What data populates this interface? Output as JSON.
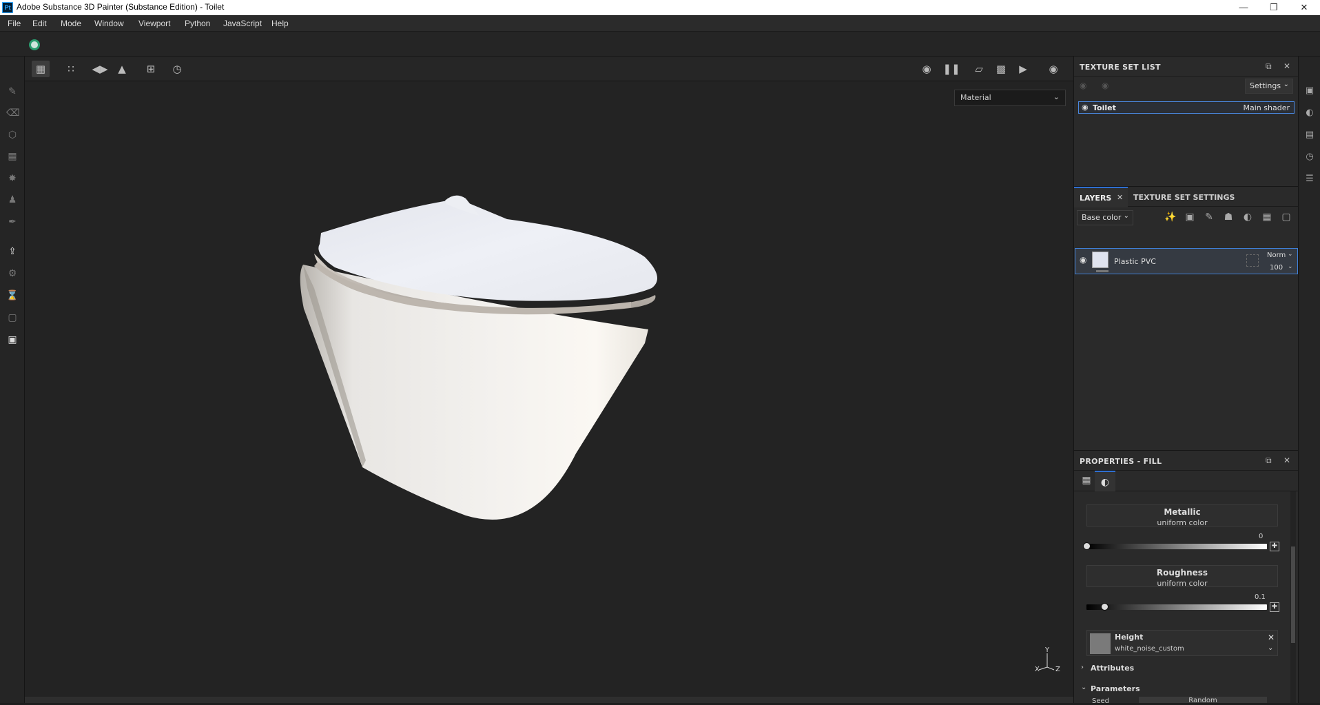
{
  "window": {
    "app_icon": "Pt",
    "title": "Adobe Substance 3D Painter (Substance Edition) - Toilet",
    "minimize_icon": "minimize-icon",
    "restore_icon": "restore-icon",
    "close_icon": "close-icon"
  },
  "menu": [
    "File",
    "Edit",
    "Mode",
    "Window",
    "Viewport",
    "Python",
    "JavaScript",
    "Help"
  ],
  "viewport": {
    "display_select": "Material",
    "axis_y": "Y",
    "axis_x": "X",
    "axis_z": "Z"
  },
  "texture_set_list": {
    "title": "TEXTURE SET LIST",
    "settings_label": "Settings",
    "item_name": "Toilet",
    "item_shader": "Main shader"
  },
  "layers": {
    "tab_layers": "LAYERS",
    "tab_settings": "TEXTURE SET SETTINGS",
    "channel_select": "Base color",
    "layer_name": "Plastic PVC",
    "blend_mode": "Norm",
    "opacity": "100"
  },
  "properties": {
    "title": "PROPERTIES - FILL",
    "metallic_label": "Metallic",
    "metallic_sub": "uniform color",
    "metallic_value": "0",
    "metallic_fraction": 0.0,
    "roughness_label": "Roughness",
    "roughness_sub": "uniform color",
    "roughness_value": "0.1",
    "roughness_fraction": 0.1,
    "height_label": "Height",
    "height_source": "white_noise_custom",
    "attributes_label": "Attributes",
    "parameters_label": "Parameters",
    "seed_label": "Seed",
    "seed_button": "Random"
  },
  "colors": {
    "accent_blue": "#2f6fd0",
    "spinner_green": "#2a9b6e",
    "panel_bg": "#2a2a2a",
    "viewport_bg": "#232323"
  }
}
